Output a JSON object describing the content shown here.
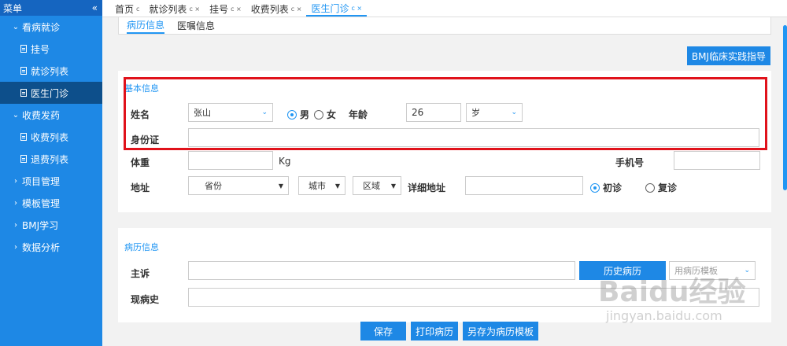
{
  "sidebar": {
    "header": "菜单",
    "collapse_icon": "«",
    "items": [
      {
        "label": "看病就诊",
        "level": 0,
        "expanded": true
      },
      {
        "label": "挂号",
        "level": 1
      },
      {
        "label": "就诊列表",
        "level": 1
      },
      {
        "label": "医生门诊",
        "level": 1,
        "active": true
      },
      {
        "label": "收费发药",
        "level": 0,
        "expanded": true
      },
      {
        "label": "收费列表",
        "level": 1
      },
      {
        "label": "退费列表",
        "level": 1
      },
      {
        "label": "项目管理",
        "level": 0,
        "expanded": false
      },
      {
        "label": "模板管理",
        "level": 0,
        "expanded": false
      },
      {
        "label": "BMJ学习",
        "level": 0,
        "expanded": false
      },
      {
        "label": "数据分析",
        "level": 0,
        "expanded": false
      }
    ]
  },
  "tabs": [
    {
      "label": "首页",
      "mark": "c",
      "closable": false
    },
    {
      "label": "就诊列表",
      "mark": "c ×",
      "closable": true
    },
    {
      "label": "挂号",
      "mark": "c ×",
      "closable": true
    },
    {
      "label": "收费列表",
      "mark": "c ×",
      "closable": true
    },
    {
      "label": "医生门诊",
      "mark": "c ×",
      "closable": true,
      "active": true
    }
  ],
  "subtabs": [
    {
      "label": "病历信息",
      "active": true
    },
    {
      "label": "医嘱信息",
      "active": false
    }
  ],
  "guide_button": "BMJ临床实践指导",
  "basic_info": {
    "title": "基本信息",
    "name_label": "姓名",
    "name_value": "张山",
    "gender_male": "男",
    "gender_female": "女",
    "gender_selected": "男",
    "age_label": "年龄",
    "age_value": "26",
    "age_unit": "岁",
    "id_label": "身份证",
    "id_value": "",
    "weight_label": "体重",
    "weight_value": "",
    "weight_unit": "Kg",
    "phone_label": "手机号",
    "phone_value": "",
    "address_label": "地址",
    "province": "省份",
    "city": "城市",
    "district": "区域",
    "detail_address_label": "详细地址",
    "detail_address_value": "",
    "visit_first": "初诊",
    "visit_return": "复诊",
    "visit_selected": "初诊"
  },
  "record_info": {
    "title": "病历信息",
    "complaint_label": "主诉",
    "complaint_value": "",
    "history_button": "历史病历",
    "template_select": "用病历模板",
    "present_label": "现病史",
    "present_value": ""
  },
  "bottom_buttons": {
    "save": "保存",
    "print": "打印病历",
    "save_template": "另存为病历模板"
  },
  "watermark": {
    "brand": "Baidu经验",
    "url": "jingyan.baidu.com"
  },
  "colors": {
    "accent": "#1e88e5",
    "sidebar_active": "#0d4f8b",
    "highlight": "#e0121b"
  }
}
